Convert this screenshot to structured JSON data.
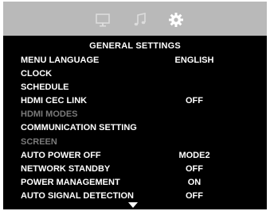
{
  "tabs": [
    {
      "icon": "monitor-icon",
      "active": false
    },
    {
      "icon": "music-note-icon",
      "active": false
    },
    {
      "icon": "gear-icon",
      "active": true
    }
  ],
  "title": "GENERAL  SETTINGS",
  "menu": [
    {
      "label": "MENU LANGUAGE",
      "value": "ENGLISH",
      "enabled": true
    },
    {
      "label": "CLOCK",
      "value": "",
      "enabled": true
    },
    {
      "label": "SCHEDULE",
      "value": "",
      "enabled": true
    },
    {
      "label": "HDMI CEC LINK",
      "value": "OFF",
      "enabled": true
    },
    {
      "label": "HDMI MODES",
      "value": "",
      "enabled": false
    },
    {
      "label": "COMMUNICATION SETTING",
      "value": "",
      "enabled": true
    },
    {
      "label": "SCREEN",
      "value": "",
      "enabled": false
    },
    {
      "label": "AUTO POWER OFF",
      "value": "MODE2",
      "enabled": true
    },
    {
      "label": "NETWORK STANDBY",
      "value": "OFF",
      "enabled": true
    },
    {
      "label": "POWER MANAGEMENT",
      "value": "ON",
      "enabled": true
    },
    {
      "label": "AUTO SIGNAL DETECTION",
      "value": "OFF",
      "enabled": true
    }
  ],
  "colors": {
    "background": "#000000",
    "tab_bar": "#b9b9b9",
    "text": "#ffffff",
    "disabled_text": "#7a7a7a"
  }
}
